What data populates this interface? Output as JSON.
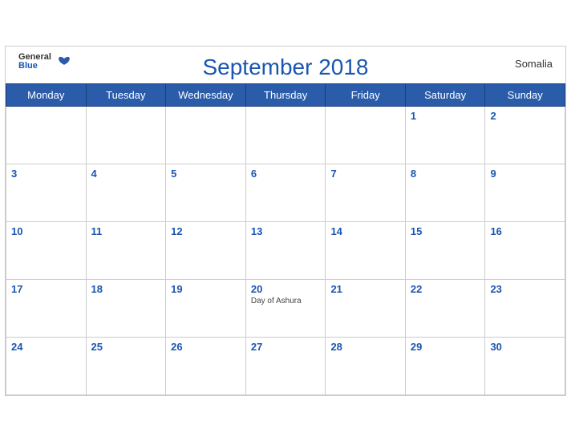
{
  "header": {
    "title": "September 2018",
    "country": "Somalia",
    "logo_general": "General",
    "logo_blue": "Blue"
  },
  "weekdays": [
    "Monday",
    "Tuesday",
    "Wednesday",
    "Thursday",
    "Friday",
    "Saturday",
    "Sunday"
  ],
  "weeks": [
    [
      {
        "day": "",
        "holiday": ""
      },
      {
        "day": "",
        "holiday": ""
      },
      {
        "day": "",
        "holiday": ""
      },
      {
        "day": "",
        "holiday": ""
      },
      {
        "day": "",
        "holiday": ""
      },
      {
        "day": "1",
        "holiday": ""
      },
      {
        "day": "2",
        "holiday": ""
      }
    ],
    [
      {
        "day": "3",
        "holiday": ""
      },
      {
        "day": "4",
        "holiday": ""
      },
      {
        "day": "5",
        "holiday": ""
      },
      {
        "day": "6",
        "holiday": ""
      },
      {
        "day": "7",
        "holiday": ""
      },
      {
        "day": "8",
        "holiday": ""
      },
      {
        "day": "9",
        "holiday": ""
      }
    ],
    [
      {
        "day": "10",
        "holiday": ""
      },
      {
        "day": "11",
        "holiday": ""
      },
      {
        "day": "12",
        "holiday": ""
      },
      {
        "day": "13",
        "holiday": ""
      },
      {
        "day": "14",
        "holiday": ""
      },
      {
        "day": "15",
        "holiday": ""
      },
      {
        "day": "16",
        "holiday": ""
      }
    ],
    [
      {
        "day": "17",
        "holiday": ""
      },
      {
        "day": "18",
        "holiday": ""
      },
      {
        "day": "19",
        "holiday": ""
      },
      {
        "day": "20",
        "holiday": "Day of Ashura"
      },
      {
        "day": "21",
        "holiday": ""
      },
      {
        "day": "22",
        "holiday": ""
      },
      {
        "day": "23",
        "holiday": ""
      }
    ],
    [
      {
        "day": "24",
        "holiday": ""
      },
      {
        "day": "25",
        "holiday": ""
      },
      {
        "day": "26",
        "holiday": ""
      },
      {
        "day": "27",
        "holiday": ""
      },
      {
        "day": "28",
        "holiday": ""
      },
      {
        "day": "29",
        "holiday": ""
      },
      {
        "day": "30",
        "holiday": ""
      }
    ]
  ]
}
